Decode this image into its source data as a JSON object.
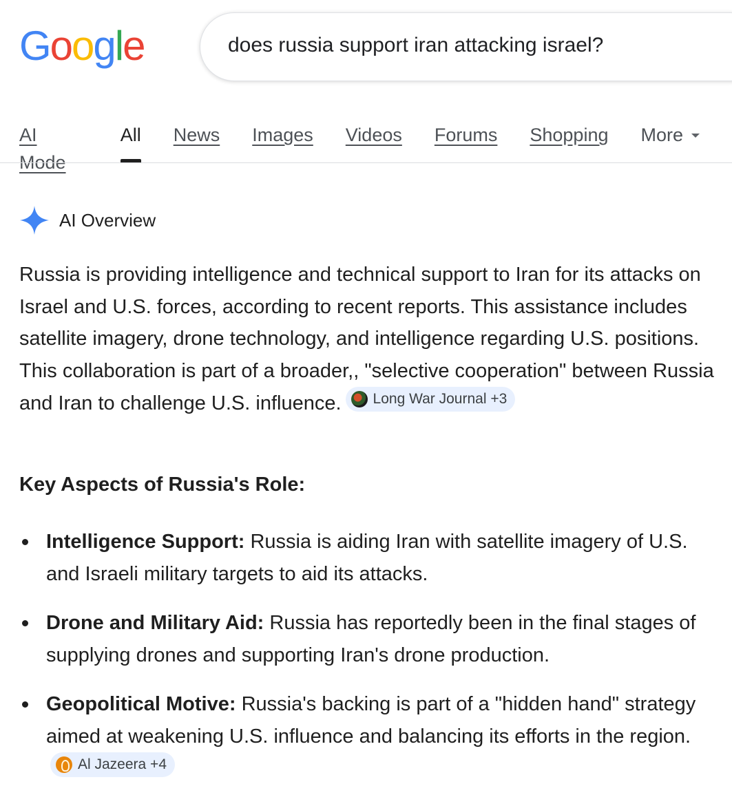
{
  "logo": {
    "letters": [
      {
        "char": "G",
        "color": "#4285F4"
      },
      {
        "char": "o",
        "color": "#EA4335"
      },
      {
        "char": "o",
        "color": "#FBBC05"
      },
      {
        "char": "g",
        "color": "#4285F4"
      },
      {
        "char": "l",
        "color": "#34A853"
      },
      {
        "char": "e",
        "color": "#EA4335"
      }
    ]
  },
  "search": {
    "query": "does russia support iran attacking israel?"
  },
  "tabs": [
    {
      "label": "AI Mode",
      "active": false
    },
    {
      "label": "All",
      "active": true
    },
    {
      "label": "News",
      "active": false
    },
    {
      "label": "Images",
      "active": false
    },
    {
      "label": "Videos",
      "active": false
    },
    {
      "label": "Forums",
      "active": false
    },
    {
      "label": "Shopping",
      "active": false
    },
    {
      "label": "More",
      "active": false
    }
  ],
  "ai_overview": {
    "title": "AI Overview",
    "sparkle_color": "#4285F4",
    "intro": "Russia is providing intelligence and technical support to Iran for its attacks on Israel and U.S. forces, according to recent reports. This assistance includes satellite imagery, drone technology, and intelligence regarding U.S. positions. This collaboration is part of a broader,, \"selective cooperation\" between Russia and Iran to challenge U.S. influence.",
    "intro_source": {
      "label": "Long War Journal +3",
      "icon": "globe-icon"
    },
    "section_title": "Key Aspects of Russia's Role:",
    "bullets": [
      {
        "term": "Intelligence Support:",
        "text": "Russia is aiding Iran with satellite imagery of U.S. and Israeli military targets to aid its attacks."
      },
      {
        "term": "Drone and Military Aid:",
        "text": "Russia has reportedly been in the final stages of supplying drones and supporting Iran's drone production."
      },
      {
        "term": "Geopolitical Motive:",
        "text": "Russia's backing is part of a \"hidden hand\" strategy aimed at weakening U.S. influence and balancing its efforts in the region.",
        "source": {
          "label": "Al Jazeera +4",
          "icon": "al-jazeera-icon"
        }
      }
    ]
  },
  "colors": {
    "chip_background": "#e8f0fe",
    "text": "#1f1f1f",
    "tab_text": "#4d5156"
  }
}
